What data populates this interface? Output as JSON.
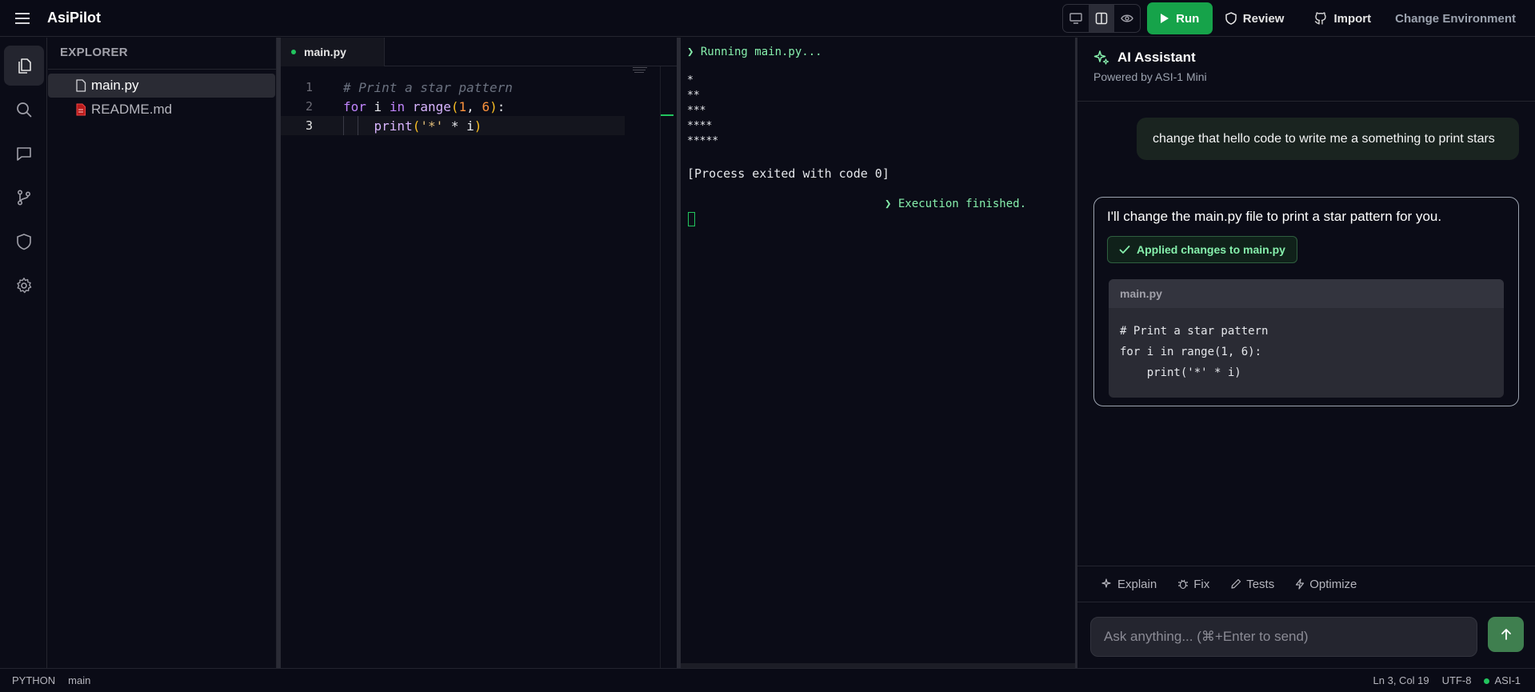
{
  "app": {
    "title": "AsiPilot"
  },
  "toolbar": {
    "run_label": "Run",
    "review_label": "Review",
    "import_label": "Import",
    "env_label": "Change Environment",
    "brand_color": "#16a34a"
  },
  "explorer": {
    "title": "EXPLORER",
    "files": [
      {
        "name": "main.py",
        "icon": "file-icon",
        "active": true
      },
      {
        "name": "README.md",
        "icon": "markdown-file-icon",
        "active": false
      }
    ]
  },
  "editor": {
    "tab_label": "main.py",
    "line_numbers": [
      "1",
      "2",
      "3"
    ],
    "lines": [
      "# Print a star pattern",
      "for i in range(1, 6):",
      "    print('*' * i)"
    ]
  },
  "terminal": {
    "running": "❯ Running main.py...",
    "output": [
      "*",
      "**",
      "***",
      "****",
      "*****"
    ],
    "exit": "[Process exited with code 0]",
    "finished": "❯ Execution finished."
  },
  "assistant": {
    "title": "AI Assistant",
    "subtitle": "Powered by ASI-1 Mini",
    "user_message": "change that hello code to write me a something to print stars",
    "ai_message": "I'll change the main.py file to print a star pattern for you.",
    "applied_label": "Applied changes to main.py",
    "code_file": "main.py",
    "code": "# Print a star pattern\nfor i in range(1, 6):\n    print('*' * i)",
    "actions": [
      "Explain",
      "Fix",
      "Tests",
      "Optimize"
    ],
    "input_placeholder": "Ask anything... (⌘+Enter to send)"
  },
  "status": {
    "language": "PYTHON",
    "branch": "main",
    "cursor": "Ln 3, Col 19",
    "encoding": "UTF-8",
    "model": "ASI-1"
  }
}
